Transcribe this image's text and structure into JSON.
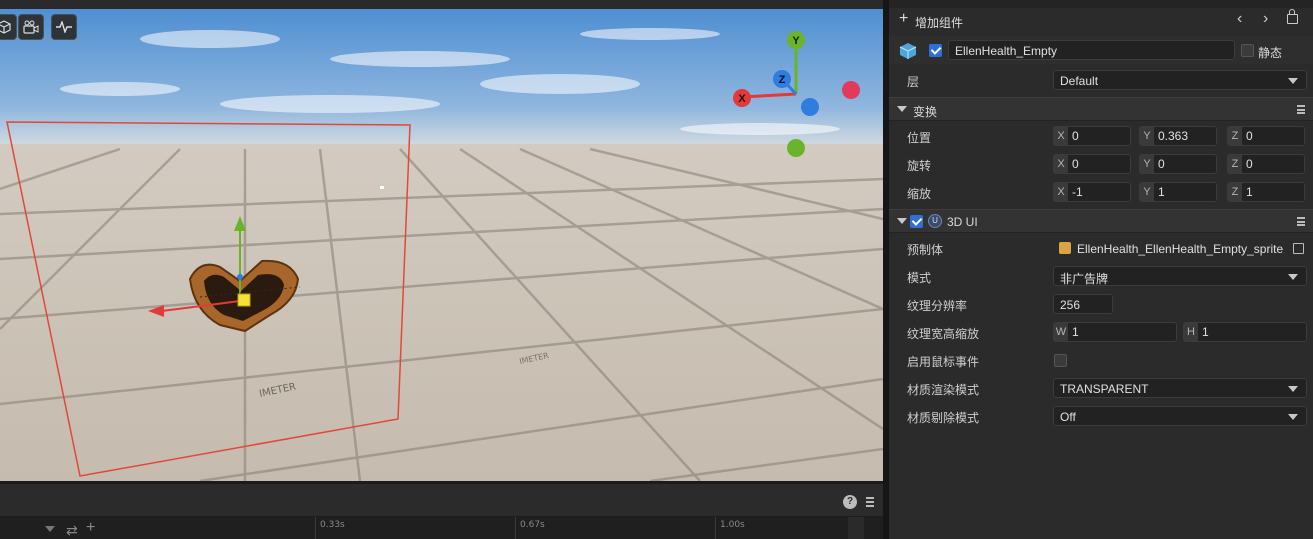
{
  "scene": {
    "gizmo_axes": {
      "x": "X",
      "y": "Y",
      "z": "Z"
    },
    "floor_text": "IMETER",
    "colors": {
      "sky_top": "#5a97d6",
      "floor": "#c9bfb3",
      "selection": "#e2483a",
      "x_axis": "#e23a3a",
      "y_axis": "#6ab42c",
      "z_axis": "#2f7de0"
    }
  },
  "viewport_toolbar": {
    "icons": [
      "cube-icon",
      "camera-icon",
      "pulse-icon"
    ]
  },
  "timeline": {
    "ticks": [
      "0.33s",
      "0.67s",
      "1.00s"
    ]
  },
  "inspector": {
    "add_component": "增加组件",
    "object": {
      "name": "EllenHealth_Empty",
      "static_label": "静态",
      "enabled": true,
      "static": false
    },
    "layer": {
      "label": "层",
      "value": "Default"
    },
    "transform": {
      "title": "变换",
      "position": {
        "label": "位置",
        "x": "0",
        "y": "0.363",
        "z": "0"
      },
      "rotation": {
        "label": "旋转",
        "x": "0",
        "y": "0",
        "z": "0"
      },
      "scale": {
        "label": "缩放",
        "x": "-1",
        "y": "1",
        "z": "1"
      }
    },
    "ui3d": {
      "title": "3D UI",
      "enabled": true,
      "prefab": {
        "label": "预制体",
        "value": "EllenHealth_EllenHealth_Empty_sprite"
      },
      "mode": {
        "label": "模式",
        "value": "非广告牌"
      },
      "texture_resolution": {
        "label": "纹理分辨率",
        "value": "256"
      },
      "texture_aspect": {
        "label": "纹理宽高缩放",
        "w": "1",
        "h": "1"
      },
      "mouse_events": {
        "label": "启用鼠标事件",
        "checked": false
      },
      "render_mode": {
        "label": "材质渲染模式",
        "value": "TRANSPARENT"
      },
      "cull_mode": {
        "label": "材质剔除模式",
        "value": "Off"
      }
    }
  }
}
